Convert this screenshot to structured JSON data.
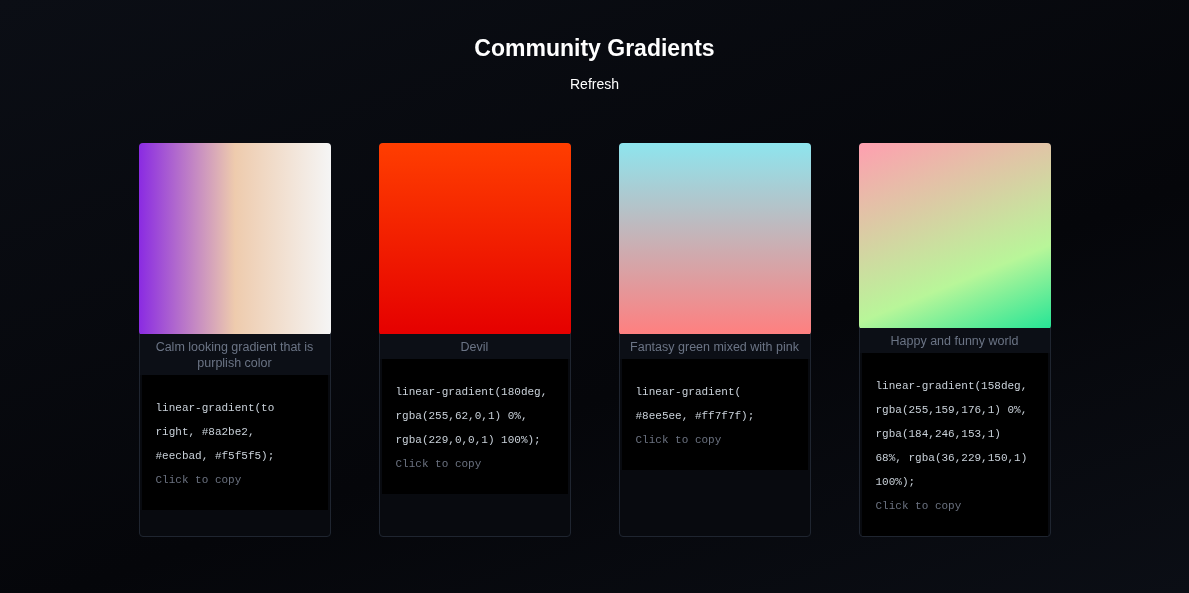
{
  "title": "Community Gradients",
  "refresh_button": "Refresh",
  "cards": [
    {
      "description": "Calm looking gradient that is purplish color",
      "code": "linear-gradient(to right, #8a2be2, #eecbad, #f5f5f5);",
      "hint": "Click to copy"
    },
    {
      "description": "Devil",
      "code": "linear-gradient(180deg, rgba(255,62,0,1) 0%, rgba(229,0,0,1) 100%);",
      "hint": "Click to copy"
    },
    {
      "description": "Fantasy green mixed with pink",
      "code": "linear-gradient( #8ee5ee, #ff7f7f);",
      "hint": "Click to copy"
    },
    {
      "description": "Happy and funny world",
      "code": "linear-gradient(158deg, rgba(255,159,176,1) 0%, rgba(184,246,153,1) 68%, rgba(36,229,150,1) 100%);",
      "hint": "Click to copy"
    }
  ]
}
